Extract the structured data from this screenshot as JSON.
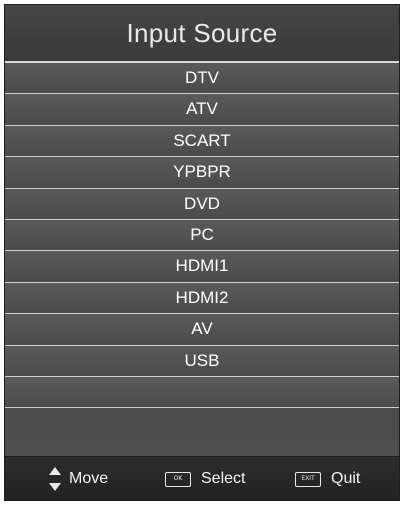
{
  "menu": {
    "title": "Input Source"
  },
  "sources": [
    {
      "label": "DTV"
    },
    {
      "label": "ATV"
    },
    {
      "label": "SCART"
    },
    {
      "label": "YPBPR"
    },
    {
      "label": "DVD"
    },
    {
      "label": "PC"
    },
    {
      "label": "HDMI1"
    },
    {
      "label": "HDMI2"
    },
    {
      "label": "AV"
    },
    {
      "label": "USB"
    }
  ],
  "footer": {
    "move_label": "Move",
    "select_label": "Select",
    "select_key": "OK",
    "quit_label": "Quit",
    "quit_key": "EXIT"
  },
  "colors": {
    "panel": "#4f4f4f",
    "title_bar": "#3e3e3e",
    "footer_bar": "#262626",
    "divider": "#cfcfcf",
    "text": "#ffffff"
  },
  "icons": {
    "move": "up-down-arrows-icon",
    "select": "ok-key-icon",
    "quit": "exit-key-icon"
  }
}
